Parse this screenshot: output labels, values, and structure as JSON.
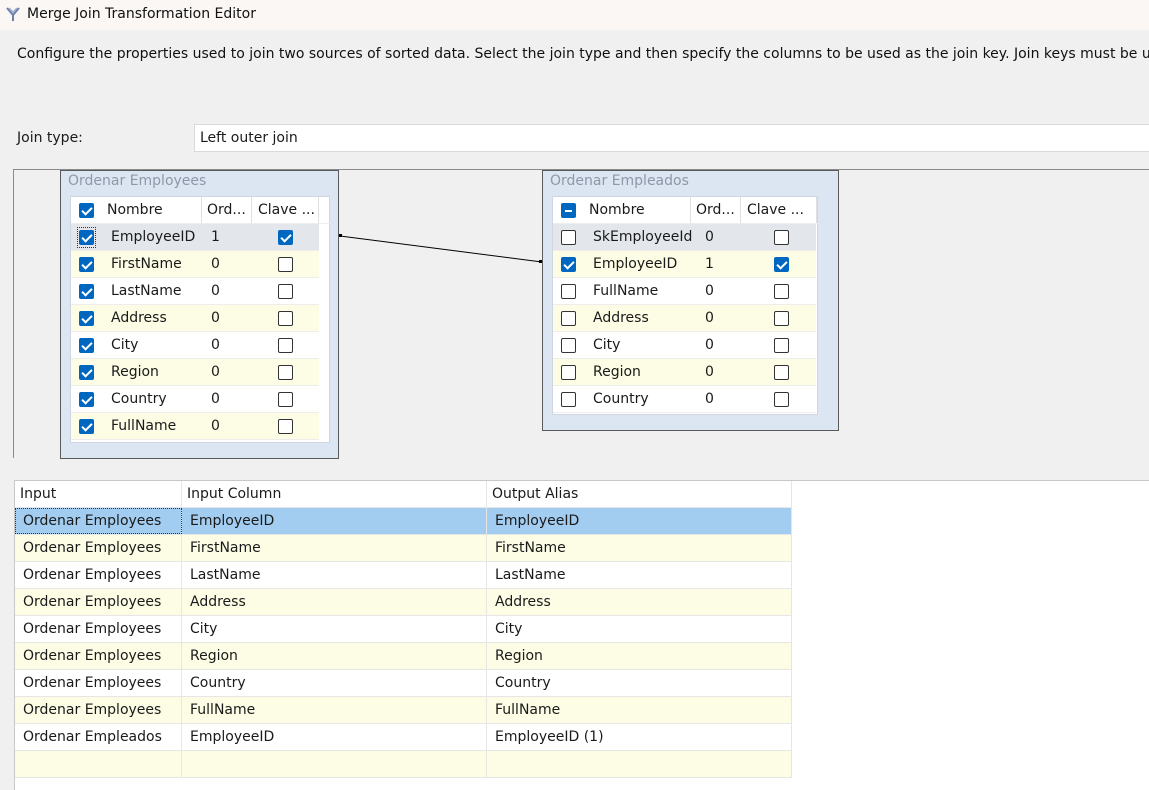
{
  "window": {
    "title": "Merge Join Transformation Editor",
    "icon": "merge-join-icon"
  },
  "description": "Configure the properties used to join two sources of sorted data. Select the join type and then specify the columns to be used as the join key. Join keys must be used in the order of the sort.",
  "join_type": {
    "label": "Join type:",
    "value": "Left outer join"
  },
  "left_table": {
    "title": "Ordenar Employees",
    "header_checked": "checked",
    "columns": [
      "Nombre",
      "Ord...",
      "Clave ..."
    ],
    "rows": [
      {
        "name": "EmployeeID",
        "order": "1",
        "selected": true,
        "key": true
      },
      {
        "name": "FirstName",
        "order": "0",
        "selected": true,
        "key": false
      },
      {
        "name": "LastName",
        "order": "0",
        "selected": true,
        "key": false
      },
      {
        "name": "Address",
        "order": "0",
        "selected": true,
        "key": false
      },
      {
        "name": "City",
        "order": "0",
        "selected": true,
        "key": false
      },
      {
        "name": "Region",
        "order": "0",
        "selected": true,
        "key": false
      },
      {
        "name": "Country",
        "order": "0",
        "selected": true,
        "key": false
      },
      {
        "name": "FullName",
        "order": "0",
        "selected": true,
        "key": false
      }
    ]
  },
  "right_table": {
    "title": "Ordenar Empleados",
    "header_checked": "indeterminate",
    "columns": [
      "Nombre",
      "Ord...",
      "Clave ..."
    ],
    "rows": [
      {
        "name": "SkEmployeeId",
        "order": "0",
        "selected": false,
        "key": false
      },
      {
        "name": "EmployeeID",
        "order": "1",
        "selected": true,
        "key": true
      },
      {
        "name": "FullName",
        "order": "0",
        "selected": false,
        "key": false
      },
      {
        "name": "Address",
        "order": "0",
        "selected": false,
        "key": false
      },
      {
        "name": "City",
        "order": "0",
        "selected": false,
        "key": false
      },
      {
        "name": "Region",
        "order": "0",
        "selected": false,
        "key": false
      },
      {
        "name": "Country",
        "order": "0",
        "selected": false,
        "key": false
      }
    ]
  },
  "output": {
    "columns": [
      "Input",
      "Input Column",
      "Output Alias"
    ],
    "rows": [
      [
        "Ordenar Employees",
        "EmployeeID",
        "EmployeeID"
      ],
      [
        "Ordenar Employees",
        "FirstName",
        "FirstName"
      ],
      [
        "Ordenar Employees",
        "LastName",
        "LastName"
      ],
      [
        "Ordenar Employees",
        "Address",
        "Address"
      ],
      [
        "Ordenar Employees",
        "City",
        "City"
      ],
      [
        "Ordenar Employees",
        "Region",
        "Region"
      ],
      [
        "Ordenar Employees",
        "Country",
        "Country"
      ],
      [
        "Ordenar Employees",
        "FullName",
        "FullName"
      ],
      [
        "Ordenar Empleados",
        "EmployeeID",
        "EmployeeID (1)"
      ],
      [
        "",
        "",
        ""
      ]
    ]
  }
}
